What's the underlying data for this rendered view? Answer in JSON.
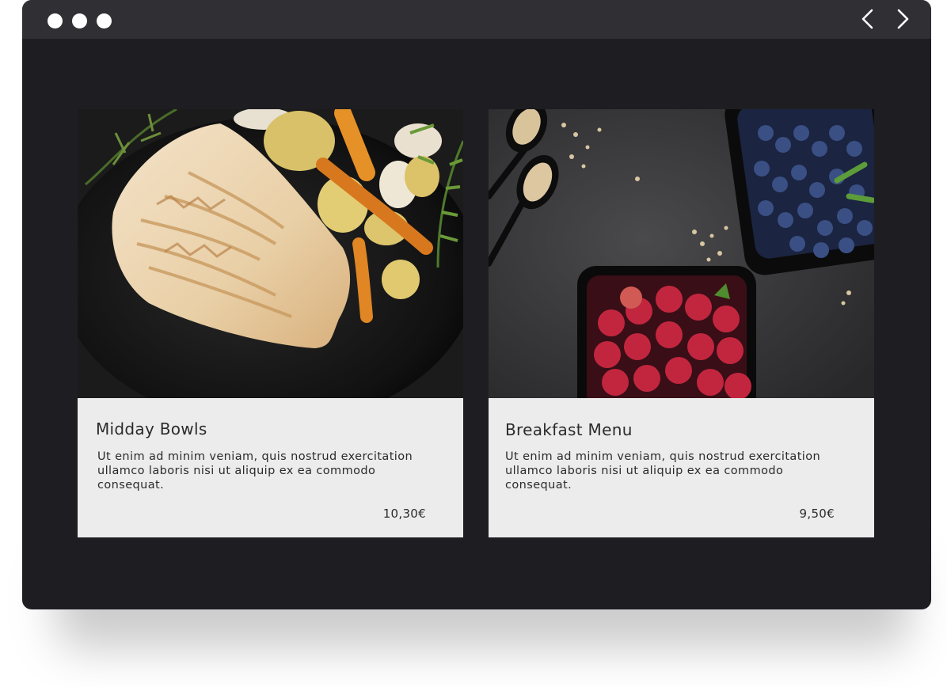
{
  "window": {
    "controls": [
      "window-dot-1",
      "window-dot-2",
      "window-dot-3"
    ],
    "nav": {
      "prev_icon": "chevron-left-icon",
      "next_icon": "chevron-right-icon"
    }
  },
  "cards": [
    {
      "image": "grilled-fish-with-roasted-vegetables",
      "title": "Midday Bowls",
      "description": "Ut enim ad minim veniam, quis nostrud exercitation ullamco laboris nisi ut aliquip ex ea commodo consequat.",
      "price": "10,30€"
    },
    {
      "image": "blueberries-raspberries-and-oats",
      "title": "Breakfast Menu",
      "description": "Ut enim ad minim veniam, quis nostrud exercitation ullamco laboris nisi ut aliquip ex ea commodo consequat.",
      "price": "9,50€"
    }
  ],
  "colors": {
    "window_bg": "#1e1d22",
    "titlebar_bg": "#2f2f34",
    "card_bg": "#ececec",
    "text": "#2b2b2b"
  }
}
